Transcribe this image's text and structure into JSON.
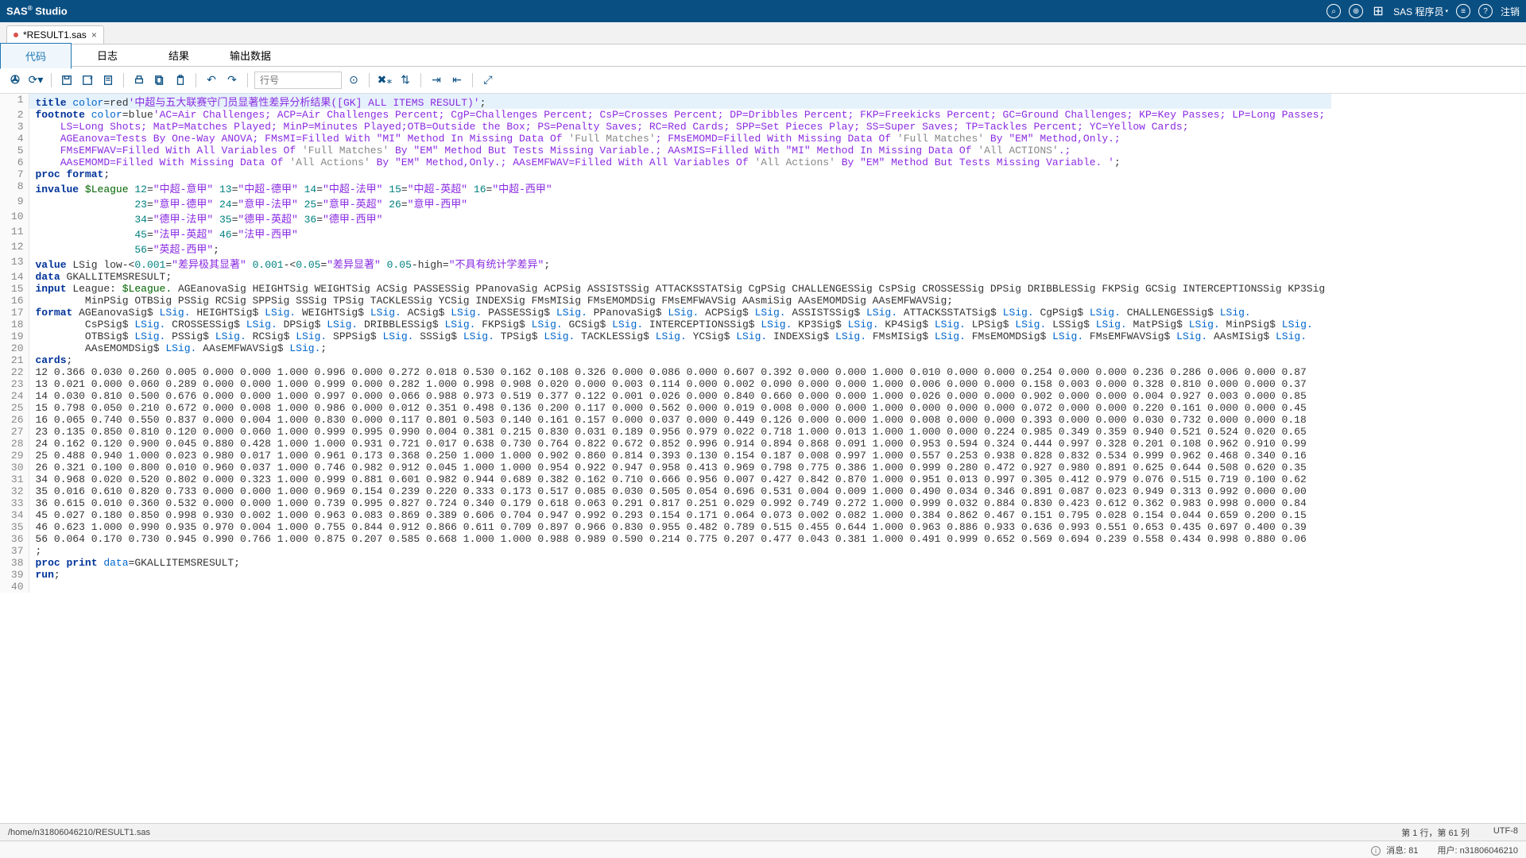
{
  "header": {
    "title_prefix": "SAS",
    "title_suffix": " Studio",
    "role_label": "SAS 程序员",
    "signout": "注销"
  },
  "file_tab": {
    "name": "*RESULT1.sas"
  },
  "sub_tabs": {
    "code": "代码",
    "log": "日志",
    "results": "结果",
    "output": "输出数据"
  },
  "toolbar": {
    "goto_placeholder": "行号"
  },
  "path_bar": {
    "path": "/home/n31806046210/RESULT1.sas",
    "cursor": "第 1 行，第 61 列",
    "encoding": "UTF-8"
  },
  "status_bar": {
    "messages_label": "消息:",
    "messages_count": "81",
    "user_label": "用户:",
    "user_value": "n31806046210"
  },
  "code_lines": [
    {
      "n": 1,
      "hl": true,
      "segs": [
        [
          "kw",
          "title"
        ],
        [
          "plain",
          " "
        ],
        [
          "opt",
          "color"
        ],
        [
          "plain",
          "="
        ],
        [
          "plain",
          "red"
        ],
        [
          "str",
          "'中超与五大联赛守门员显著性差异分析结果([GK] ALL ITEMS RESULT)'"
        ],
        [
          "plain",
          ";"
        ]
      ]
    },
    {
      "n": 2,
      "segs": [
        [
          "kw",
          "footnote"
        ],
        [
          "plain",
          " "
        ],
        [
          "opt",
          "color"
        ],
        [
          "plain",
          "="
        ],
        [
          "plain",
          "blue"
        ],
        [
          "str",
          "'AC=Air Challenges; ACP=Air Challenges Percent; CgP=Challenges Percent; CsP=Crosses Percent; DP=Dribbles Percent; FKP=Freekicks Percent; GC=Ground Challenges; KP=Key Passes; LP=Long Passes;"
        ]
      ]
    },
    {
      "n": 3,
      "segs": [
        [
          "str",
          "    LS=Long Shots; MatP=Matches Played; MinP=Minutes Played;OTB=Outside the Box; PS=Penalty Saves; RC=Red Cards; SPP=Set Pieces Play; SS=Super Saves; TP=Tackles Percent; YC=Yellow Cards;"
        ]
      ]
    },
    {
      "n": 4,
      "segs": [
        [
          "str",
          "    AGEanova=Tests By One-Way ANOVA; FMsMI=Filled With \"MI\" Method In Missing Data Of "
        ],
        [
          "com",
          "'Full Matches'"
        ],
        [
          "str",
          "; FMsEMOMD=Filled With Missing Data Of "
        ],
        [
          "com",
          "'Full Matches'"
        ],
        [
          "str",
          " By \"EM\" Method,Only.;"
        ]
      ]
    },
    {
      "n": 5,
      "segs": [
        [
          "str",
          "    FMsEMFWAV=Filled With All Variables Of "
        ],
        [
          "com",
          "'Full Matches'"
        ],
        [
          "str",
          " By \"EM\" Method But Tests Missing Variable.; AAsMIS=Filled With \"MI\" Method In Missing Data Of "
        ],
        [
          "com",
          "'All ACTIONS'"
        ],
        [
          "str",
          ".;"
        ]
      ]
    },
    {
      "n": 6,
      "segs": [
        [
          "str",
          "    AAsEMOMD=Filled With Missing Data Of "
        ],
        [
          "com",
          "'All Actions'"
        ],
        [
          "str",
          " By \"EM\" Method,Only.; AAsEMFWAV=Filled With All Variables Of "
        ],
        [
          "com",
          "'All Actions'"
        ],
        [
          "str",
          " By \"EM\" Method But Tests Missing Variable. '"
        ],
        [
          "plain",
          ";"
        ]
      ]
    },
    {
      "n": 7,
      "segs": [
        [
          "kw",
          "proc format"
        ],
        [
          "plain",
          ";"
        ]
      ]
    },
    {
      "n": 8,
      "segs": [
        [
          "kw",
          "invalue"
        ],
        [
          "plain",
          " "
        ],
        [
          "fmt",
          "$League"
        ],
        [
          "plain",
          " "
        ],
        [
          "num",
          "12"
        ],
        [
          "plain",
          "="
        ],
        [
          "str",
          "\"中超-意甲\""
        ],
        [
          "plain",
          " "
        ],
        [
          "num",
          "13"
        ],
        [
          "plain",
          "="
        ],
        [
          "str",
          "\"中超-德甲\""
        ],
        [
          "plain",
          " "
        ],
        [
          "num",
          "14"
        ],
        [
          "plain",
          "="
        ],
        [
          "str",
          "\"中超-法甲\""
        ],
        [
          "plain",
          " "
        ],
        [
          "num",
          "15"
        ],
        [
          "plain",
          "="
        ],
        [
          "str",
          "\"中超-英超\""
        ],
        [
          "plain",
          " "
        ],
        [
          "num",
          "16"
        ],
        [
          "plain",
          "="
        ],
        [
          "str",
          "\"中超-西甲\""
        ]
      ]
    },
    {
      "n": 9,
      "segs": [
        [
          "plain",
          "                "
        ],
        [
          "num",
          "23"
        ],
        [
          "plain",
          "="
        ],
        [
          "str",
          "\"意甲-德甲\""
        ],
        [
          "plain",
          " "
        ],
        [
          "num",
          "24"
        ],
        [
          "plain",
          "="
        ],
        [
          "str",
          "\"意甲-法甲\""
        ],
        [
          "plain",
          " "
        ],
        [
          "num",
          "25"
        ],
        [
          "plain",
          "="
        ],
        [
          "str",
          "\"意甲-英超\""
        ],
        [
          "plain",
          " "
        ],
        [
          "num",
          "26"
        ],
        [
          "plain",
          "="
        ],
        [
          "str",
          "\"意甲-西甲\""
        ]
      ]
    },
    {
      "n": 10,
      "segs": [
        [
          "plain",
          "                "
        ],
        [
          "num",
          "34"
        ],
        [
          "plain",
          "="
        ],
        [
          "str",
          "\"德甲-法甲\""
        ],
        [
          "plain",
          " "
        ],
        [
          "num",
          "35"
        ],
        [
          "plain",
          "="
        ],
        [
          "str",
          "\"德甲-英超\""
        ],
        [
          "plain",
          " "
        ],
        [
          "num",
          "36"
        ],
        [
          "plain",
          "="
        ],
        [
          "str",
          "\"德甲-西甲\""
        ]
      ]
    },
    {
      "n": 11,
      "segs": [
        [
          "plain",
          "                "
        ],
        [
          "num",
          "45"
        ],
        [
          "plain",
          "="
        ],
        [
          "str",
          "\"法甲-英超\""
        ],
        [
          "plain",
          " "
        ],
        [
          "num",
          "46"
        ],
        [
          "plain",
          "="
        ],
        [
          "str",
          "\"法甲-西甲\""
        ]
      ]
    },
    {
      "n": 12,
      "segs": [
        [
          "plain",
          "                "
        ],
        [
          "num",
          "56"
        ],
        [
          "plain",
          "="
        ],
        [
          "str",
          "\"英超-西甲\""
        ],
        [
          "plain",
          ";"
        ]
      ]
    },
    {
      "n": 13,
      "segs": [
        [
          "kw",
          "value"
        ],
        [
          "plain",
          " LSig low-<"
        ],
        [
          "num",
          "0.001"
        ],
        [
          "plain",
          "="
        ],
        [
          "str",
          "\"差异极其显著\""
        ],
        [
          "plain",
          " "
        ],
        [
          "num",
          "0.001"
        ],
        [
          "plain",
          "-<"
        ],
        [
          "num",
          "0.05"
        ],
        [
          "plain",
          "="
        ],
        [
          "str",
          "\"差异显著\""
        ],
        [
          "plain",
          " "
        ],
        [
          "num",
          "0.05"
        ],
        [
          "plain",
          "-high="
        ],
        [
          "str",
          "\"不具有统计学差异\""
        ],
        [
          "plain",
          ";"
        ]
      ]
    },
    {
      "n": 14,
      "segs": [
        [
          "kw",
          "data"
        ],
        [
          "plain",
          " GKALLITEMSRESULT;"
        ]
      ]
    },
    {
      "n": 15,
      "segs": [
        [
          "kw",
          "input"
        ],
        [
          "plain",
          " League: "
        ],
        [
          "fmt",
          "$League."
        ],
        [
          "plain",
          " AGEanovaSig HEIGHTSig WEIGHTSig ACSig PASSESSig PPanovaSig ACPSig ASSISTSSig ATTACKSSTATSig CgPSig CHALLENGESSig CsPSig CROSSESSig DPSig DRIBBLESSig FKPSig GCSig INTERCEPTIONSSig KP3Sig"
        ]
      ]
    },
    {
      "n": 16,
      "segs": [
        [
          "plain",
          "        MinPSig OTBSig PSSig RCSig SPPSig SSSig TPSig TACKLESSig YCSig INDEXSig FMsMISig FMsEMOMDSig FMsEMFWAVSig AAsmiSig AAsEMOMDSig AAsEMFWAVSig;"
        ]
      ]
    },
    {
      "n": 17,
      "segs": [
        [
          "kw",
          "format"
        ],
        [
          "plain",
          " AGEanovaSig$ "
        ],
        [
          "opt",
          "LSig."
        ],
        [
          "plain",
          " HEIGHTSig$ "
        ],
        [
          "opt",
          "LSig."
        ],
        [
          "plain",
          " WEIGHTSig$ "
        ],
        [
          "opt",
          "LSig."
        ],
        [
          "plain",
          " ACSig$ "
        ],
        [
          "opt",
          "LSig."
        ],
        [
          "plain",
          " PASSESSig$ "
        ],
        [
          "opt",
          "LSig."
        ],
        [
          "plain",
          " PPanovaSig$ "
        ],
        [
          "opt",
          "LSig."
        ],
        [
          "plain",
          " ACPSig$ "
        ],
        [
          "opt",
          "LSig."
        ],
        [
          "plain",
          " ASSISTSSig$ "
        ],
        [
          "opt",
          "LSig."
        ],
        [
          "plain",
          " ATTACKSSTATSig$ "
        ],
        [
          "opt",
          "LSig."
        ],
        [
          "plain",
          " CgPSig$ "
        ],
        [
          "opt",
          "LSig."
        ],
        [
          "plain",
          " CHALLENGESSig$ "
        ],
        [
          "opt",
          "LSig."
        ]
      ]
    },
    {
      "n": 18,
      "segs": [
        [
          "plain",
          "        CsPSig$ "
        ],
        [
          "opt",
          "LSig."
        ],
        [
          "plain",
          " CROSSESSig$ "
        ],
        [
          "opt",
          "LSig."
        ],
        [
          "plain",
          " DPSig$ "
        ],
        [
          "opt",
          "LSig."
        ],
        [
          "plain",
          " DRIBBLESSig$ "
        ],
        [
          "opt",
          "LSig."
        ],
        [
          "plain",
          " FKPSig$ "
        ],
        [
          "opt",
          "LSig."
        ],
        [
          "plain",
          " GCSig$ "
        ],
        [
          "opt",
          "LSig."
        ],
        [
          "plain",
          " INTERCEPTIONSSig$ "
        ],
        [
          "opt",
          "LSig."
        ],
        [
          "plain",
          " KP3Sig$ "
        ],
        [
          "opt",
          "LSig."
        ],
        [
          "plain",
          " KP4Sig$ "
        ],
        [
          "opt",
          "LSig."
        ],
        [
          "plain",
          " LPSig$ "
        ],
        [
          "opt",
          "LSig."
        ],
        [
          "plain",
          " LSSig$ "
        ],
        [
          "opt",
          "LSig."
        ],
        [
          "plain",
          " MatPSig$ "
        ],
        [
          "opt",
          "LSig."
        ],
        [
          "plain",
          " MinPSig$ "
        ],
        [
          "opt",
          "LSig."
        ]
      ]
    },
    {
      "n": 19,
      "segs": [
        [
          "plain",
          "        OTBSig$ "
        ],
        [
          "opt",
          "LSig."
        ],
        [
          "plain",
          " PSSig$ "
        ],
        [
          "opt",
          "LSig."
        ],
        [
          "plain",
          " RCSig$ "
        ],
        [
          "opt",
          "LSig."
        ],
        [
          "plain",
          " SPPSig$ "
        ],
        [
          "opt",
          "LSig."
        ],
        [
          "plain",
          " SSSig$ "
        ],
        [
          "opt",
          "LSig."
        ],
        [
          "plain",
          " TPSig$ "
        ],
        [
          "opt",
          "LSig."
        ],
        [
          "plain",
          " TACKLESSig$ "
        ],
        [
          "opt",
          "LSig."
        ],
        [
          "plain",
          " YCSig$ "
        ],
        [
          "opt",
          "LSig."
        ],
        [
          "plain",
          " INDEXSig$ "
        ],
        [
          "opt",
          "LSig."
        ],
        [
          "plain",
          " FMsMISig$ "
        ],
        [
          "opt",
          "LSig."
        ],
        [
          "plain",
          " FMsEMOMDSig$ "
        ],
        [
          "opt",
          "LSig."
        ],
        [
          "plain",
          " FMsEMFWAVSig$ "
        ],
        [
          "opt",
          "LSig."
        ],
        [
          "plain",
          " AAsMISig$ "
        ],
        [
          "opt",
          "LSig."
        ]
      ]
    },
    {
      "n": 20,
      "segs": [
        [
          "plain",
          "        AAsEMOMDSig$ "
        ],
        [
          "opt",
          "LSig."
        ],
        [
          "plain",
          " AAsEMFWAVSig$ "
        ],
        [
          "opt",
          "LSig."
        ],
        [
          "plain",
          ";"
        ]
      ]
    },
    {
      "n": 21,
      "segs": [
        [
          "kw",
          "cards"
        ],
        [
          "plain",
          ";"
        ]
      ]
    },
    {
      "n": 22,
      "segs": [
        [
          "plain",
          "12 0.366 0.030 0.260 0.005 0.000 0.000 1.000 0.996 0.000 0.272 0.018 0.530 0.162 0.108 0.326 0.000 0.086 0.000 0.607 0.392 0.000 0.000 1.000 0.010 0.000 0.000 0.254 0.000 0.000 0.236 0.286 0.006 0.000 0.87"
        ]
      ]
    },
    {
      "n": 23,
      "segs": [
        [
          "plain",
          "13 0.021 0.000 0.060 0.289 0.000 0.000 1.000 0.999 0.000 0.282 1.000 0.998 0.908 0.020 0.000 0.003 0.114 0.000 0.002 0.090 0.000 0.000 1.000 0.006 0.000 0.000 0.158 0.003 0.000 0.328 0.810 0.000 0.000 0.37"
        ]
      ]
    },
    {
      "n": 24,
      "segs": [
        [
          "plain",
          "14 0.030 0.810 0.500 0.676 0.000 0.000 1.000 0.997 0.000 0.066 0.988 0.973 0.519 0.377 0.122 0.001 0.026 0.000 0.840 0.660 0.000 0.000 1.000 0.026 0.000 0.000 0.902 0.000 0.000 0.004 0.927 0.003 0.000 0.85"
        ]
      ]
    },
    {
      "n": 25,
      "segs": [
        [
          "plain",
          "15 0.798 0.050 0.210 0.672 0.000 0.008 1.000 0.986 0.000 0.012 0.351 0.498 0.136 0.200 0.117 0.000 0.562 0.000 0.019 0.008 0.000 0.000 1.000 0.000 0.000 0.000 0.072 0.000 0.000 0.220 0.161 0.000 0.000 0.45"
        ]
      ]
    },
    {
      "n": 26,
      "segs": [
        [
          "plain",
          "16 0.065 0.740 0.550 0.837 0.000 0.004 1.000 0.830 0.000 0.117 0.801 0.503 0.140 0.161 0.157 0.000 0.037 0.000 0.449 0.126 0.000 0.000 1.000 0.008 0.000 0.000 0.393 0.000 0.000 0.030 0.732 0.000 0.000 0.18"
        ]
      ]
    },
    {
      "n": 27,
      "segs": [
        [
          "plain",
          "23 0.135 0.850 0.810 0.120 0.000 0.060 1.000 0.999 0.995 0.990 0.004 0.381 0.215 0.830 0.031 0.189 0.956 0.979 0.022 0.718 1.000 0.013 1.000 1.000 0.000 0.224 0.985 0.349 0.359 0.940 0.521 0.524 0.020 0.65"
        ]
      ]
    },
    {
      "n": 28,
      "segs": [
        [
          "plain",
          "24 0.162 0.120 0.900 0.045 0.880 0.428 1.000 1.000 0.931 0.721 0.017 0.638 0.730 0.764 0.822 0.672 0.852 0.996 0.914 0.894 0.868 0.091 1.000 0.953 0.594 0.324 0.444 0.997 0.328 0.201 0.108 0.962 0.910 0.99"
        ]
      ]
    },
    {
      "n": 29,
      "segs": [
        [
          "plain",
          "25 0.488 0.940 1.000 0.023 0.980 0.017 1.000 0.961 0.173 0.368 0.250 1.000 1.000 0.902 0.860 0.814 0.393 0.130 0.154 0.187 0.008 0.997 1.000 0.557 0.253 0.938 0.828 0.832 0.534 0.999 0.962 0.468 0.340 0.16"
        ]
      ]
    },
    {
      "n": 30,
      "segs": [
        [
          "plain",
          "26 0.321 0.100 0.800 0.010 0.960 0.037 1.000 0.746 0.982 0.912 0.045 1.000 1.000 0.954 0.922 0.947 0.958 0.413 0.969 0.798 0.775 0.386 1.000 0.999 0.280 0.472 0.927 0.980 0.891 0.625 0.644 0.508 0.620 0.35"
        ]
      ]
    },
    {
      "n": 31,
      "segs": [
        [
          "plain",
          "34 0.968 0.020 0.520 0.802 0.000 0.323 1.000 0.999 0.881 0.601 0.982 0.944 0.689 0.382 0.162 0.710 0.666 0.956 0.007 0.427 0.842 0.870 1.000 0.951 0.013 0.997 0.305 0.412 0.979 0.076 0.515 0.719 0.100 0.62"
        ]
      ]
    },
    {
      "n": 32,
      "segs": [
        [
          "plain",
          "35 0.016 0.610 0.820 0.733 0.000 0.000 1.000 0.969 0.154 0.239 0.220 0.333 0.173 0.517 0.085 0.030 0.505 0.054 0.696 0.531 0.004 0.009 1.000 0.490 0.034 0.346 0.891 0.087 0.023 0.949 0.313 0.992 0.000 0.00"
        ]
      ]
    },
    {
      "n": 33,
      "segs": [
        [
          "plain",
          "36 0.615 0.010 0.360 0.532 0.000 0.000 1.000 0.739 0.995 0.827 0.724 0.340 0.179 0.618 0.063 0.291 0.817 0.251 0.029 0.992 0.749 0.272 1.000 0.999 0.032 0.884 0.830 0.423 0.612 0.362 0.983 0.998 0.000 0.84"
        ]
      ]
    },
    {
      "n": 34,
      "segs": [
        [
          "plain",
          "45 0.027 0.180 0.850 0.998 0.930 0.002 1.000 0.963 0.083 0.869 0.389 0.606 0.704 0.947 0.992 0.293 0.154 0.171 0.064 0.073 0.002 0.082 1.000 0.384 0.862 0.467 0.151 0.795 0.028 0.154 0.044 0.659 0.200 0.15"
        ]
      ]
    },
    {
      "n": 35,
      "segs": [
        [
          "plain",
          "46 0.623 1.000 0.990 0.935 0.970 0.004 1.000 0.755 0.844 0.912 0.866 0.611 0.709 0.897 0.966 0.830 0.955 0.482 0.789 0.515 0.455 0.644 1.000 0.963 0.886 0.933 0.636 0.993 0.551 0.653 0.435 0.697 0.400 0.39"
        ]
      ]
    },
    {
      "n": 36,
      "segs": [
        [
          "plain",
          "56 0.064 0.170 0.730 0.945 0.990 0.766 1.000 0.875 0.207 0.585 0.668 1.000 1.000 0.988 0.989 0.590 0.214 0.775 0.207 0.477 0.043 0.381 1.000 0.491 0.999 0.652 0.569 0.694 0.239 0.558 0.434 0.998 0.880 0.06"
        ]
      ]
    },
    {
      "n": 37,
      "segs": [
        [
          "plain",
          ";"
        ]
      ]
    },
    {
      "n": 38,
      "segs": [
        [
          "kw",
          "proc print"
        ],
        [
          "plain",
          " "
        ],
        [
          "opt",
          "data"
        ],
        [
          "plain",
          "=GKALLITEMSRESULT;"
        ]
      ]
    },
    {
      "n": 39,
      "segs": [
        [
          "kw",
          "run"
        ],
        [
          "plain",
          ";"
        ]
      ]
    },
    {
      "n": 40,
      "segs": [
        [
          "plain",
          " "
        ]
      ]
    }
  ]
}
